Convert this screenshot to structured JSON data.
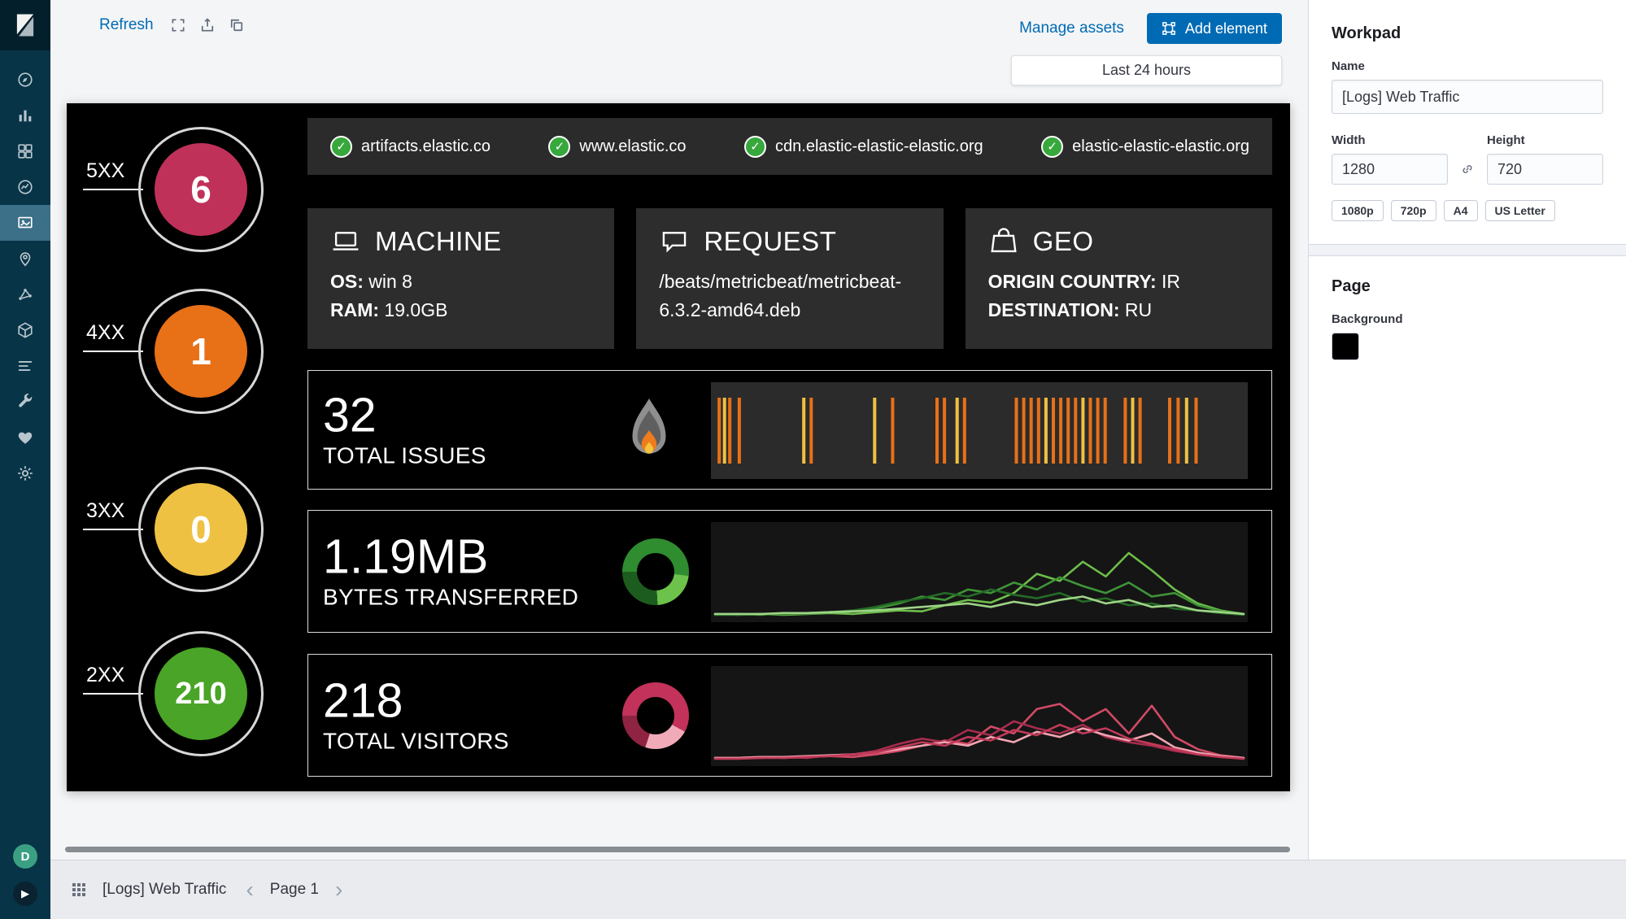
{
  "app": {
    "name": "Kibana Canvas"
  },
  "sidebar": {
    "items": [
      {
        "name": "discover"
      },
      {
        "name": "visualize"
      },
      {
        "name": "dashboard"
      },
      {
        "name": "timelion"
      },
      {
        "name": "canvas",
        "active": true
      },
      {
        "name": "maps"
      },
      {
        "name": "machine-learning"
      },
      {
        "name": "infrastructure"
      },
      {
        "name": "logs"
      },
      {
        "name": "dev-tools"
      },
      {
        "name": "monitoring"
      },
      {
        "name": "management"
      }
    ],
    "space_badge": "D"
  },
  "toolbar": {
    "refresh": "Refresh",
    "icons": [
      "fullscreen",
      "export",
      "clone"
    ],
    "manage_assets": "Manage assets",
    "add_element": "Add element",
    "time_range": "Last 24 hours"
  },
  "workpad": {
    "status_codes": [
      {
        "label": "5XX",
        "value": "6",
        "color": "#c0315a"
      },
      {
        "label": "4XX",
        "value": "1",
        "color": "#e87017"
      },
      {
        "label": "3XX",
        "value": "0",
        "color": "#efc143"
      },
      {
        "label": "2XX",
        "value": "210",
        "color": "#4aa427"
      }
    ],
    "domains": [
      "artifacts.elastic.co",
      "www.elastic.co",
      "cdn.elastic-elastic-elastic.org",
      "elastic-elastic-elastic.org"
    ],
    "cards": [
      {
        "icon": "laptop",
        "title": "MACHINE",
        "lines": [
          {
            "label": "OS:",
            "value": "win 8"
          },
          {
            "label": "RAM:",
            "value": "19.0GB"
          }
        ]
      },
      {
        "icon": "chat",
        "title": "REQUEST",
        "lines": [
          {
            "label": "",
            "value": "/beats/metricbeat/metricbeat-6.3.2-amd64.deb"
          }
        ]
      },
      {
        "icon": "geo",
        "title": "GEO",
        "lines": [
          {
            "label": "ORIGIN COUNTRY:",
            "value": "IR"
          },
          {
            "label": "DESTINATION:",
            "value": "RU"
          }
        ]
      }
    ],
    "metrics": [
      {
        "value": "32",
        "label": "TOTAL ISSUES",
        "icon": "flame",
        "chart": {
          "type": "ticks",
          "palette": [
            "#e87017",
            "#efc143"
          ],
          "ticks": [
            [
              0.8,
              0
            ],
            [
              1.8,
              1
            ],
            [
              2.8,
              0
            ],
            [
              4.6,
              0
            ],
            [
              16.8,
              1
            ],
            [
              18.2,
              0
            ],
            [
              30.2,
              1
            ],
            [
              33.6,
              0
            ],
            [
              42,
              0
            ],
            [
              43.4,
              0
            ],
            [
              45.8,
              1
            ],
            [
              47.2,
              0
            ],
            [
              57,
              0
            ],
            [
              58.4,
              0
            ],
            [
              59.8,
              0
            ],
            [
              61.2,
              0
            ],
            [
              62.6,
              1
            ],
            [
              64,
              0
            ],
            [
              65.4,
              0
            ],
            [
              66.8,
              0
            ],
            [
              68.2,
              0
            ],
            [
              69.6,
              1
            ],
            [
              71,
              0
            ],
            [
              72.4,
              0
            ],
            [
              73.8,
              0
            ],
            [
              77.6,
              0
            ],
            [
              79,
              1
            ],
            [
              80.4,
              0
            ],
            [
              86,
              0
            ],
            [
              87.6,
              0
            ],
            [
              89.2,
              1
            ],
            [
              91,
              0
            ]
          ]
        }
      },
      {
        "value": "1.19MB",
        "label": "BYTES TRANSFERRED",
        "icon": "donut",
        "icon_segments": [
          {
            "pct": 52,
            "color": "#2f8c2f"
          },
          {
            "pct": 22,
            "color": "#6cc24a"
          },
          {
            "pct": 26,
            "color": "#1d5c1f"
          }
        ],
        "chart": {
          "type": "lines",
          "series": [
            {
              "color": "#6dbd4a",
              "values": [
                2,
                1,
                2,
                1,
                2,
                3,
                2,
                4,
                6,
                5,
                12,
                18,
                15,
                26,
                48,
                40,
                62,
                45,
                72,
                52,
                30,
                14,
                6,
                2
              ]
            },
            {
              "color": "#3f9437",
              "values": [
                1,
                2,
                1,
                3,
                2,
                4,
                5,
                8,
                14,
                22,
                18,
                30,
                26,
                38,
                30,
                44,
                34,
                26,
                38,
                22,
                26,
                12,
                5,
                2
              ]
            },
            {
              "color": "#256b27",
              "values": [
                1,
                1,
                2,
                2,
                3,
                4,
                6,
                10,
                16,
                20,
                26,
                22,
                30,
                24,
                20,
                26,
                16,
                20,
                12,
                14,
                8,
                6,
                3,
                1
              ]
            },
            {
              "color": "#9fd487",
              "values": [
                2,
                2,
                2,
                3,
                3,
                4,
                5,
                6,
                8,
                10,
                12,
                14,
                10,
                16,
                12,
                18,
                22,
                14,
                18,
                10,
                12,
                6,
                4,
                2
              ]
            }
          ]
        }
      },
      {
        "value": "218",
        "label": "TOTAL VISITORS",
        "icon": "donut",
        "icon_segments": [
          {
            "pct": 58,
            "color": "#c2325a"
          },
          {
            "pct": 22,
            "color": "#f0aab8"
          },
          {
            "pct": 20,
            "color": "#8e2342"
          }
        ],
        "chart": {
          "type": "lines",
          "series": [
            {
              "color": "#d14a66",
              "values": [
                2,
                2,
                3,
                2,
                3,
                4,
                3,
                6,
                10,
                16,
                22,
                18,
                38,
                30,
                58,
                64,
                44,
                58,
                30,
                62,
                26,
                12,
                5,
                2
              ]
            },
            {
              "color": "#a72c4e",
              "values": [
                1,
                2,
                2,
                3,
                2,
                5,
                6,
                10,
                18,
                24,
                20,
                34,
                28,
                44,
                36,
                30,
                40,
                26,
                20,
                16,
                10,
                6,
                3,
                1
              ]
            },
            {
              "color": "#f2a4b2",
              "values": [
                2,
                2,
                3,
                3,
                4,
                5,
                6,
                8,
                12,
                16,
                20,
                16,
                26,
                20,
                32,
                26,
                36,
                28,
                22,
                30,
                14,
                8,
                4,
                2
              ]
            },
            {
              "color": "#c13a59",
              "values": [
                1,
                1,
                2,
                2,
                3,
                4,
                6,
                8,
                14,
                20,
                16,
                26,
                22,
                34,
                28,
                40,
                30,
                36,
                24,
                18,
                12,
                6,
                3,
                1
              ]
            }
          ]
        }
      }
    ]
  },
  "settings_panel": {
    "title": "Workpad",
    "name_label": "Name",
    "name_value": "[Logs] Web Traffic",
    "width_label": "Width",
    "width_value": "1280",
    "height_label": "Height",
    "height_value": "720",
    "presets": [
      "1080p",
      "720p",
      "A4",
      "US Letter"
    ],
    "page_section": {
      "title": "Page",
      "background_label": "Background",
      "background_color": "#000000"
    }
  },
  "footer": {
    "workpad_title": "[Logs] Web Traffic",
    "page_label": "Page 1"
  }
}
